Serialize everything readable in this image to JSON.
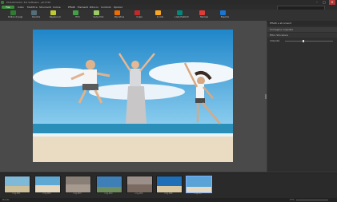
{
  "window": {
    "title": "PhotoDirector 6.0 Software - ph1739"
  },
  "menu": {
    "file": "File",
    "items": [
      "Inizio",
      "Modifica",
      "Strumenti",
      "Colore",
      "Effetti",
      "Elementi",
      "Ritocco",
      "Controlli",
      "Opzioni"
    ]
  },
  "toolbar": {
    "items": [
      {
        "label": "Ordine di pagi",
        "color": "#2e7d32"
      },
      {
        "label": "Importa",
        "color": "#546e7a"
      },
      {
        "label": "Regola luci",
        "color": "#c0ca33"
      },
      {
        "label": "Filtri",
        "color": "#43a047"
      },
      {
        "label": "Salva foto",
        "color": "#9ccc65"
      },
      {
        "label": "Ripristina",
        "color": "#ef6c00"
      },
      {
        "label": "Copia",
        "color": "#c62828"
      },
      {
        "label": "Incolla",
        "color": "#f9a825"
      },
      {
        "label": "Lista Preferiti",
        "color": "#00897b"
      },
      {
        "label": "Stampa",
        "color": "#e53935"
      },
      {
        "label": "Esporta",
        "color": "#1976d2"
      }
    ]
  },
  "panel": {
    "title": "Effetti e strumenti",
    "section1": "Immagine originale",
    "section2": "Filtro Sfocatura",
    "slider_label": "Intensità",
    "slider_level": 0.4
  },
  "filmstrip": {
    "captions": [
      "img-001",
      "img-002",
      "img-003",
      "img-004",
      "img-005",
      "img-006",
      "img-007"
    ],
    "selected_index": 6
  },
  "status": {
    "left": "Pronto",
    "zoom": "17%"
  }
}
